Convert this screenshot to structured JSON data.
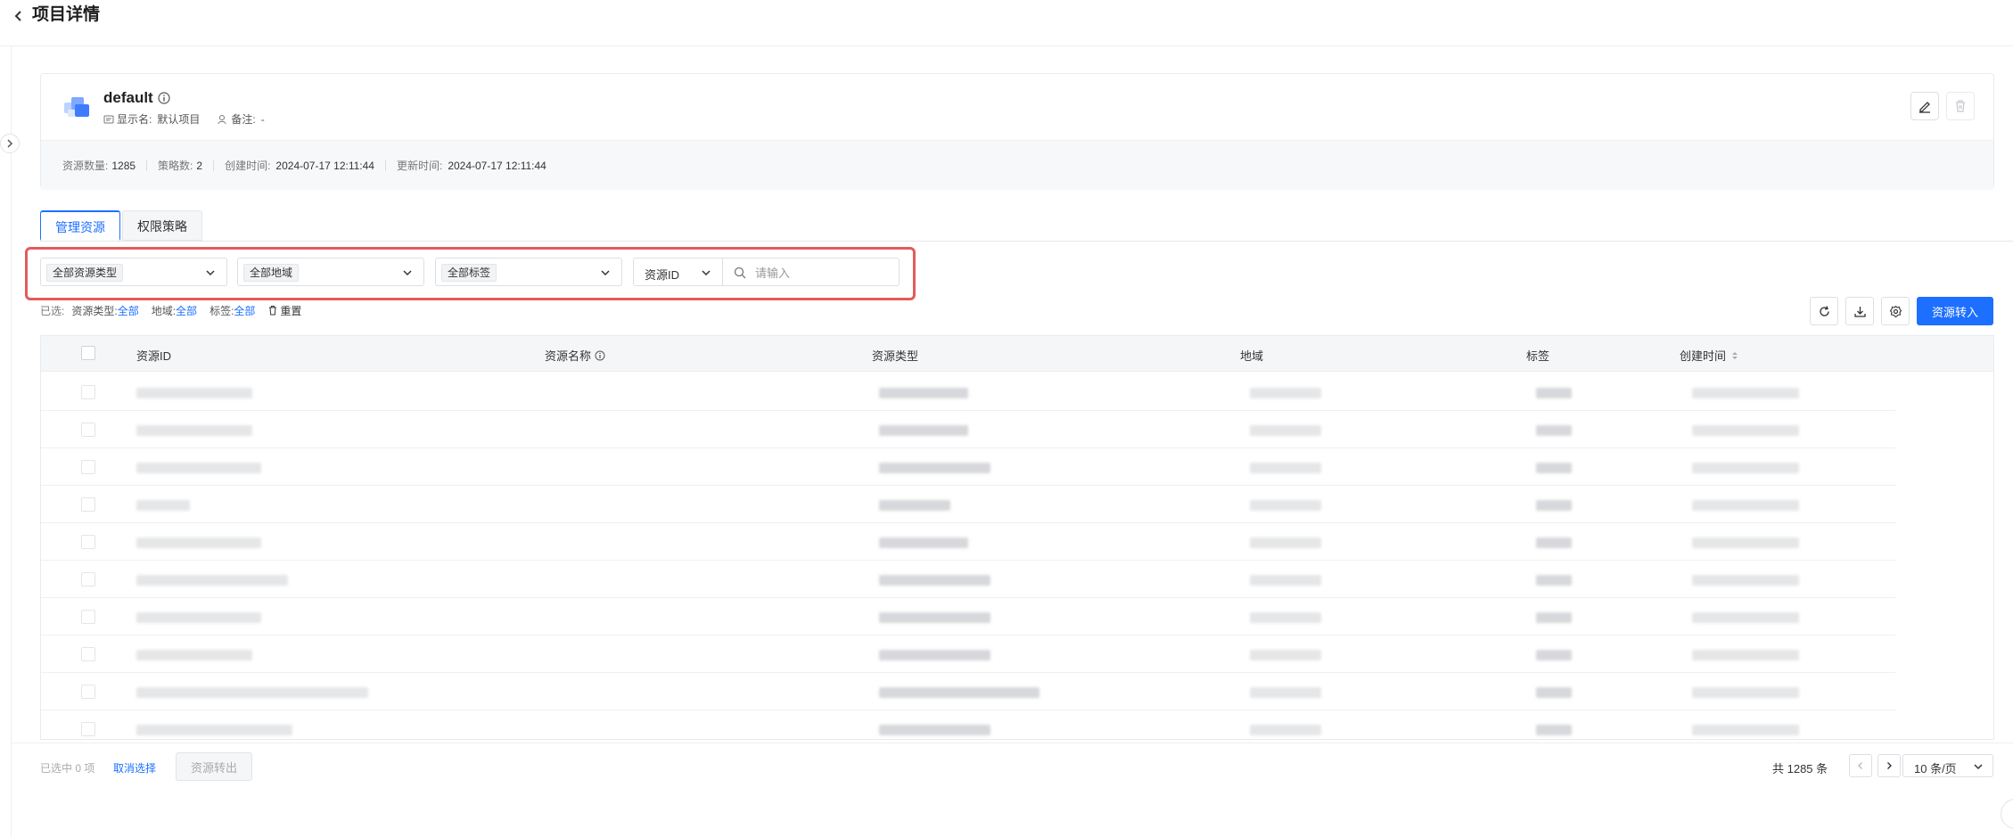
{
  "header": {
    "title": "项目详情"
  },
  "project": {
    "name": "default",
    "display_name_label": "显示名:",
    "display_name_value": "默认项目",
    "remark_label": "备注:",
    "remark_value": "-",
    "stats": {
      "resource_count_label": "资源数量:",
      "resource_count": "1285",
      "policy_count_label": "策略数:",
      "policy_count": "2",
      "created_label": "创建时间:",
      "created": "2024-07-17 12:11:44",
      "updated_label": "更新时间:",
      "updated": "2024-07-17 12:11:44"
    }
  },
  "tabs": [
    {
      "label": "管理资源",
      "active": true
    },
    {
      "label": "权限策略",
      "active": false
    }
  ],
  "filters": {
    "resource_type": "全部资源类型",
    "region": "全部地域",
    "tag": "全部标签",
    "search_field": "资源ID",
    "search_placeholder": "请输入"
  },
  "summary": {
    "prefix": "已选:",
    "resource_type_label": "资源类型:",
    "resource_type_value": "全部",
    "region_label": "地域:",
    "region_value": "全部",
    "tag_label": "标签:",
    "tag_value": "全部",
    "reset_label": "重置"
  },
  "toolbar": {
    "transfer_in_label": "资源转入"
  },
  "table": {
    "columns": [
      "资源ID",
      "资源名称",
      "资源类型",
      "地域",
      "标签",
      "创建时间"
    ]
  },
  "footer": {
    "selected_text": "已选中 0 项",
    "cancel_label": "取消选择",
    "transfer_out_label": "资源转出",
    "total_text": "共 1285 条",
    "page_size_label": "10 条/页"
  },
  "colors": {
    "primary": "#1c6fff",
    "highlight": "#e35b5b"
  }
}
